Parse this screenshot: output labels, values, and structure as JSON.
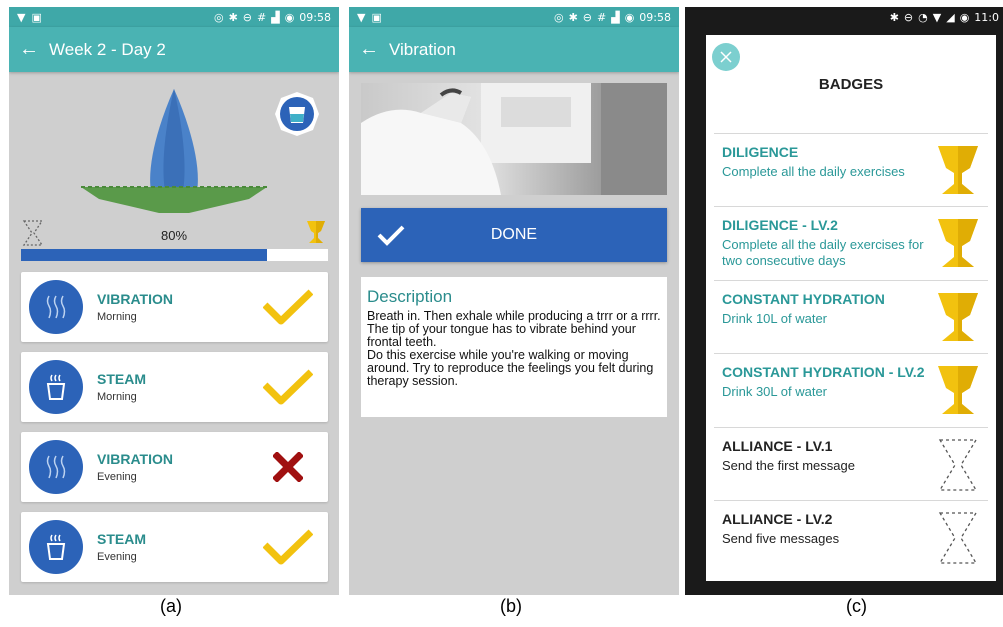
{
  "status_bar": {
    "time_a": "09:58",
    "time_b": "09:58",
    "time_c": "11:0"
  },
  "screen_a": {
    "title": "Week  2 - Day 2",
    "progress": {
      "percent_label": "80%",
      "fraction": 0.8
    },
    "exercises": [
      {
        "name": "VIBRATION",
        "time": "Morning",
        "status": "done"
      },
      {
        "name": "STEAM",
        "time": "Morning",
        "status": "done"
      },
      {
        "name": "VIBRATION",
        "time": "Evening",
        "status": "missed"
      },
      {
        "name": "STEAM",
        "time": "Evening",
        "status": "done"
      }
    ],
    "caption": "(a)"
  },
  "screen_b": {
    "title": "Vibration",
    "done_label": "DONE",
    "description_title": "Description",
    "description_text": "Breath in. Then exhale while producing a trrr or a rrrr. The tip of your tongue has to vibrate behind your frontal teeth.\nDo this exercise while you're walking or moving around. Try to reproduce the feelings you felt during therapy session.",
    "caption": "(b)"
  },
  "screen_c": {
    "title": "BADGES",
    "badges": [
      {
        "title": "DILIGENCE",
        "subtitle": "Complete all the daily exercises",
        "earned": true
      },
      {
        "title": "DILIGENCE - LV.2",
        "subtitle": "Complete all the daily exercises for two consecutive days",
        "earned": true
      },
      {
        "title": "CONSTANT HYDRATION",
        "subtitle": "Drink 10L of water",
        "earned": true
      },
      {
        "title": "CONSTANT HYDRATION - LV.2",
        "subtitle": "Drink 30L of water",
        "earned": true
      },
      {
        "title": "ALLIANCE - LV.1",
        "subtitle": "Send the first message",
        "earned": false
      },
      {
        "title": "ALLIANCE - LV.2",
        "subtitle": "Send five messages",
        "earned": false
      }
    ],
    "caption": "(c)"
  },
  "colors": {
    "teal_appbar": "#4ab3b3",
    "teal_status": "#3fa8a8",
    "blue_primary": "#2c63b8",
    "teal_text": "#2a8c8c",
    "gold": "#f2c20f",
    "missed_red": "#a01010"
  }
}
